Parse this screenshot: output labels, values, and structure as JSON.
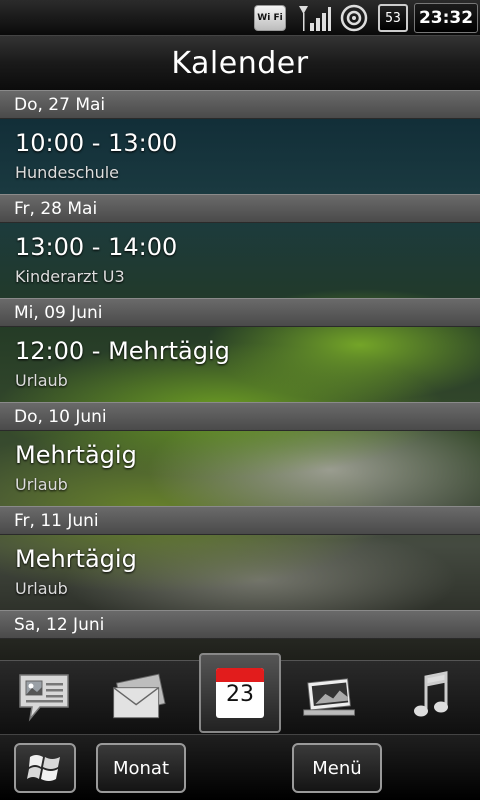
{
  "status": {
    "wifi_label": "Wi Fi",
    "battery": "53",
    "time": "23:32"
  },
  "title": "Kalender",
  "days": [
    {
      "header": "Do, 27 Mai",
      "event": {
        "time": "10:00 - 13:00",
        "title": "Hundeschule"
      }
    },
    {
      "header": "Fr, 28 Mai",
      "event": {
        "time": "13:00 - 14:00",
        "title": "Kinderarzt U3"
      }
    },
    {
      "header": "Mi, 09 Juni",
      "event": {
        "time": "12:00 - Mehrtägig",
        "title": "Urlaub"
      }
    },
    {
      "header": "Do, 10 Juni",
      "event": {
        "time": "Mehrtägig",
        "title": "Urlaub"
      }
    },
    {
      "header": "Fr, 11 Juni",
      "event": {
        "time": "Mehrtägig",
        "title": "Urlaub"
      }
    },
    {
      "header": "Sa, 12 Juni"
    }
  ],
  "dock": {
    "items": [
      "messages-icon",
      "mail-icon",
      "calendar-icon",
      "photos-icon",
      "music-icon"
    ],
    "calendar_day": "23",
    "calendar_top_color": "#e21c1c"
  },
  "softkeys": {
    "left": "Monat",
    "right": "Menü"
  }
}
